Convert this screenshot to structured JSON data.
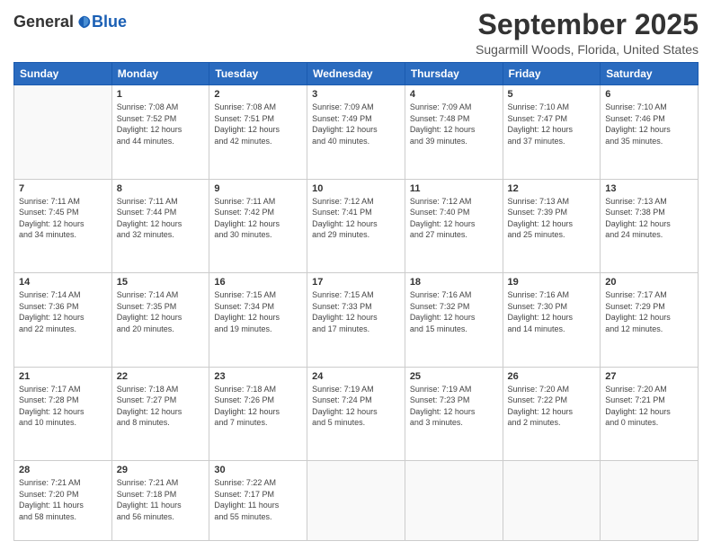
{
  "logo": {
    "general": "General",
    "blue": "Blue"
  },
  "header": {
    "month": "September 2025",
    "location": "Sugarmill Woods, Florida, United States"
  },
  "weekdays": [
    "Sunday",
    "Monday",
    "Tuesday",
    "Wednesday",
    "Thursday",
    "Friday",
    "Saturday"
  ],
  "weeks": [
    [
      {
        "day": "",
        "info": ""
      },
      {
        "day": "1",
        "info": "Sunrise: 7:08 AM\nSunset: 7:52 PM\nDaylight: 12 hours\nand 44 minutes."
      },
      {
        "day": "2",
        "info": "Sunrise: 7:08 AM\nSunset: 7:51 PM\nDaylight: 12 hours\nand 42 minutes."
      },
      {
        "day": "3",
        "info": "Sunrise: 7:09 AM\nSunset: 7:49 PM\nDaylight: 12 hours\nand 40 minutes."
      },
      {
        "day": "4",
        "info": "Sunrise: 7:09 AM\nSunset: 7:48 PM\nDaylight: 12 hours\nand 39 minutes."
      },
      {
        "day": "5",
        "info": "Sunrise: 7:10 AM\nSunset: 7:47 PM\nDaylight: 12 hours\nand 37 minutes."
      },
      {
        "day": "6",
        "info": "Sunrise: 7:10 AM\nSunset: 7:46 PM\nDaylight: 12 hours\nand 35 minutes."
      }
    ],
    [
      {
        "day": "7",
        "info": "Sunrise: 7:11 AM\nSunset: 7:45 PM\nDaylight: 12 hours\nand 34 minutes."
      },
      {
        "day": "8",
        "info": "Sunrise: 7:11 AM\nSunset: 7:44 PM\nDaylight: 12 hours\nand 32 minutes."
      },
      {
        "day": "9",
        "info": "Sunrise: 7:11 AM\nSunset: 7:42 PM\nDaylight: 12 hours\nand 30 minutes."
      },
      {
        "day": "10",
        "info": "Sunrise: 7:12 AM\nSunset: 7:41 PM\nDaylight: 12 hours\nand 29 minutes."
      },
      {
        "day": "11",
        "info": "Sunrise: 7:12 AM\nSunset: 7:40 PM\nDaylight: 12 hours\nand 27 minutes."
      },
      {
        "day": "12",
        "info": "Sunrise: 7:13 AM\nSunset: 7:39 PM\nDaylight: 12 hours\nand 25 minutes."
      },
      {
        "day": "13",
        "info": "Sunrise: 7:13 AM\nSunset: 7:38 PM\nDaylight: 12 hours\nand 24 minutes."
      }
    ],
    [
      {
        "day": "14",
        "info": "Sunrise: 7:14 AM\nSunset: 7:36 PM\nDaylight: 12 hours\nand 22 minutes."
      },
      {
        "day": "15",
        "info": "Sunrise: 7:14 AM\nSunset: 7:35 PM\nDaylight: 12 hours\nand 20 minutes."
      },
      {
        "day": "16",
        "info": "Sunrise: 7:15 AM\nSunset: 7:34 PM\nDaylight: 12 hours\nand 19 minutes."
      },
      {
        "day": "17",
        "info": "Sunrise: 7:15 AM\nSunset: 7:33 PM\nDaylight: 12 hours\nand 17 minutes."
      },
      {
        "day": "18",
        "info": "Sunrise: 7:16 AM\nSunset: 7:32 PM\nDaylight: 12 hours\nand 15 minutes."
      },
      {
        "day": "19",
        "info": "Sunrise: 7:16 AM\nSunset: 7:30 PM\nDaylight: 12 hours\nand 14 minutes."
      },
      {
        "day": "20",
        "info": "Sunrise: 7:17 AM\nSunset: 7:29 PM\nDaylight: 12 hours\nand 12 minutes."
      }
    ],
    [
      {
        "day": "21",
        "info": "Sunrise: 7:17 AM\nSunset: 7:28 PM\nDaylight: 12 hours\nand 10 minutes."
      },
      {
        "day": "22",
        "info": "Sunrise: 7:18 AM\nSunset: 7:27 PM\nDaylight: 12 hours\nand 8 minutes."
      },
      {
        "day": "23",
        "info": "Sunrise: 7:18 AM\nSunset: 7:26 PM\nDaylight: 12 hours\nand 7 minutes."
      },
      {
        "day": "24",
        "info": "Sunrise: 7:19 AM\nSunset: 7:24 PM\nDaylight: 12 hours\nand 5 minutes."
      },
      {
        "day": "25",
        "info": "Sunrise: 7:19 AM\nSunset: 7:23 PM\nDaylight: 12 hours\nand 3 minutes."
      },
      {
        "day": "26",
        "info": "Sunrise: 7:20 AM\nSunset: 7:22 PM\nDaylight: 12 hours\nand 2 minutes."
      },
      {
        "day": "27",
        "info": "Sunrise: 7:20 AM\nSunset: 7:21 PM\nDaylight: 12 hours\nand 0 minutes."
      }
    ],
    [
      {
        "day": "28",
        "info": "Sunrise: 7:21 AM\nSunset: 7:20 PM\nDaylight: 11 hours\nand 58 minutes."
      },
      {
        "day": "29",
        "info": "Sunrise: 7:21 AM\nSunset: 7:18 PM\nDaylight: 11 hours\nand 56 minutes."
      },
      {
        "day": "30",
        "info": "Sunrise: 7:22 AM\nSunset: 7:17 PM\nDaylight: 11 hours\nand 55 minutes."
      },
      {
        "day": "",
        "info": ""
      },
      {
        "day": "",
        "info": ""
      },
      {
        "day": "",
        "info": ""
      },
      {
        "day": "",
        "info": ""
      }
    ]
  ]
}
